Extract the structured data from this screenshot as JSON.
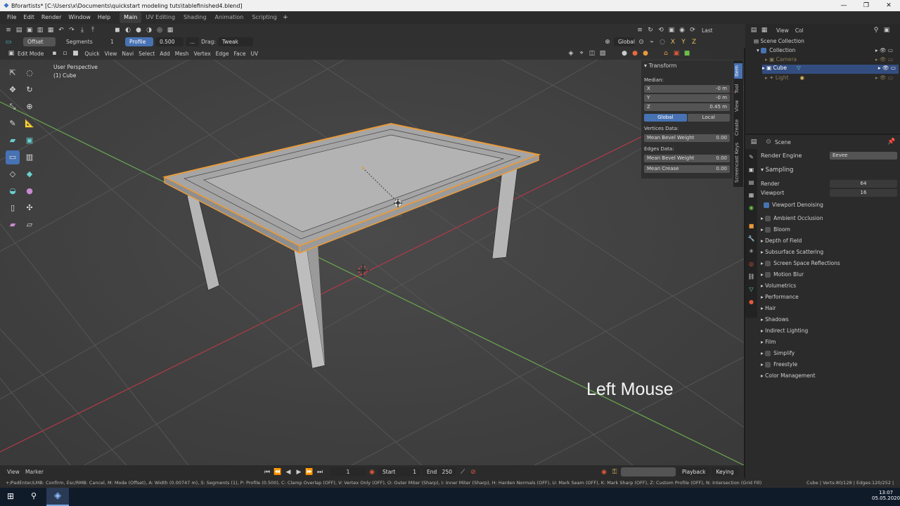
{
  "window": {
    "title": "Bforartists* [C:\\Users\\x\\Documents\\quickstart modeling tuts\\tablefinished4.blend]"
  },
  "menu": [
    "File",
    "Edit",
    "Render",
    "Window",
    "Help"
  ],
  "workspaces": [
    "Main",
    "UV Editing",
    "Shading",
    "Animation",
    "Scripting"
  ],
  "tool_header": {
    "mode_dropdown": "Offset",
    "segments_label": "Segments",
    "segments_value": "1",
    "profile_label": "Profile",
    "profile_value": "0.500",
    "ellipsis": "...",
    "drag_label": "Drag:",
    "drag_value": "Tweak",
    "transform_orientation": "Global",
    "last_label": "Last"
  },
  "edit_header": {
    "mode": "Edit Mode",
    "menus": [
      "Quick",
      "View",
      "Navi",
      "Select",
      "Add",
      "Mesh",
      "Vertex",
      "Edge",
      "Face",
      "UV"
    ]
  },
  "viewport": {
    "perspective": "User Perspective",
    "object": "(1) Cube",
    "overlay_text": "Left Mouse"
  },
  "npanel": {
    "title": "Transform",
    "median": "Median:",
    "x_label": "X",
    "x_value": "-0 m",
    "y_label": "Y",
    "y_value": "-0 m",
    "z_label": "Z",
    "z_value": "0.45 m",
    "global": "Global",
    "local": "Local",
    "vertices_data": "Vertices Data:",
    "mean_bevel_weight": "Mean Bevel Weight",
    "mean_bevel_weight_v": "0.00",
    "edges_data": "Edges Data:",
    "mean_bevel_weight_e": "Mean Bevel Weight",
    "mean_bevel_weight_e_v": "0.00",
    "mean_crease": "Mean Crease",
    "mean_crease_v": "0.00",
    "tabs": [
      "Item",
      "Tool",
      "View",
      "Create",
      "Screencast Keys"
    ]
  },
  "outliner": {
    "view_label": "View",
    "col_label": "Col",
    "items": [
      {
        "name": "Scene Collection"
      },
      {
        "name": "Collection"
      },
      {
        "name": "Camera"
      },
      {
        "name": "Cube"
      },
      {
        "name": "Light"
      }
    ]
  },
  "properties": {
    "scene_label": "Scene",
    "render_engine_label": "Render Engine",
    "render_engine_value": "Eevee",
    "sampling": "Sampling",
    "render_label": "Render",
    "render_value": "64",
    "viewport_label": "Viewport",
    "viewport_value": "16",
    "viewport_denoising": "Viewport Denoising",
    "sections": [
      {
        "label": "Ambient Occlusion",
        "checkbox": true
      },
      {
        "label": "Bloom",
        "checkbox": true
      },
      {
        "label": "Depth of Field",
        "checkbox": false
      },
      {
        "label": "Subsurface Scattering",
        "checkbox": false
      },
      {
        "label": "Screen Space Reflections",
        "checkbox": true
      },
      {
        "label": "Motion Blur",
        "checkbox": true
      },
      {
        "label": "Volumetrics",
        "checkbox": false
      },
      {
        "label": "Performance",
        "checkbox": false
      },
      {
        "label": "Hair",
        "checkbox": false
      },
      {
        "label": "Shadows",
        "checkbox": false
      },
      {
        "label": "Indirect Lighting",
        "checkbox": false
      },
      {
        "label": "Film",
        "checkbox": false
      },
      {
        "label": "Simplify",
        "checkbox": true
      },
      {
        "label": "Freestyle",
        "checkbox": true
      },
      {
        "label": "Color Management",
        "checkbox": false
      }
    ]
  },
  "timeline": {
    "view": "View",
    "marker": "Marker",
    "current_frame": "1",
    "start_label": "Start",
    "start_value": "1",
    "end_label": "End",
    "end_value": "250",
    "playback": "Playback",
    "keying": "Keying"
  },
  "statusbar": {
    "left": "+/PadEnter/LMB: Confirm, Esc/RMB: Cancel, M: Mode (Offset), A: Width (0.00747 m), S: Segments (1), P: Profile (0.500), C: Clamp Overlap (OFF), V: Vertex Only (OFF), O: Outer Miter (Sharp), I: Inner Miter (Sharp), H: Harden Normals (OFF), U: Mark Seam (OFF), K: Mark Sharp (OFF), Z: Custom Profile (OFF), N: Intersection (Grid Fill)",
    "right": "Cube | Verts:80/128 | Edges:120/252 |"
  },
  "taskbar": {
    "time": "13:07",
    "date": "05.05.2020"
  },
  "colors": {
    "accent": "#4772b3",
    "selection_orange": "#e89a3c",
    "x_axis": "#b03a48",
    "y_axis": "#6aa84f"
  }
}
